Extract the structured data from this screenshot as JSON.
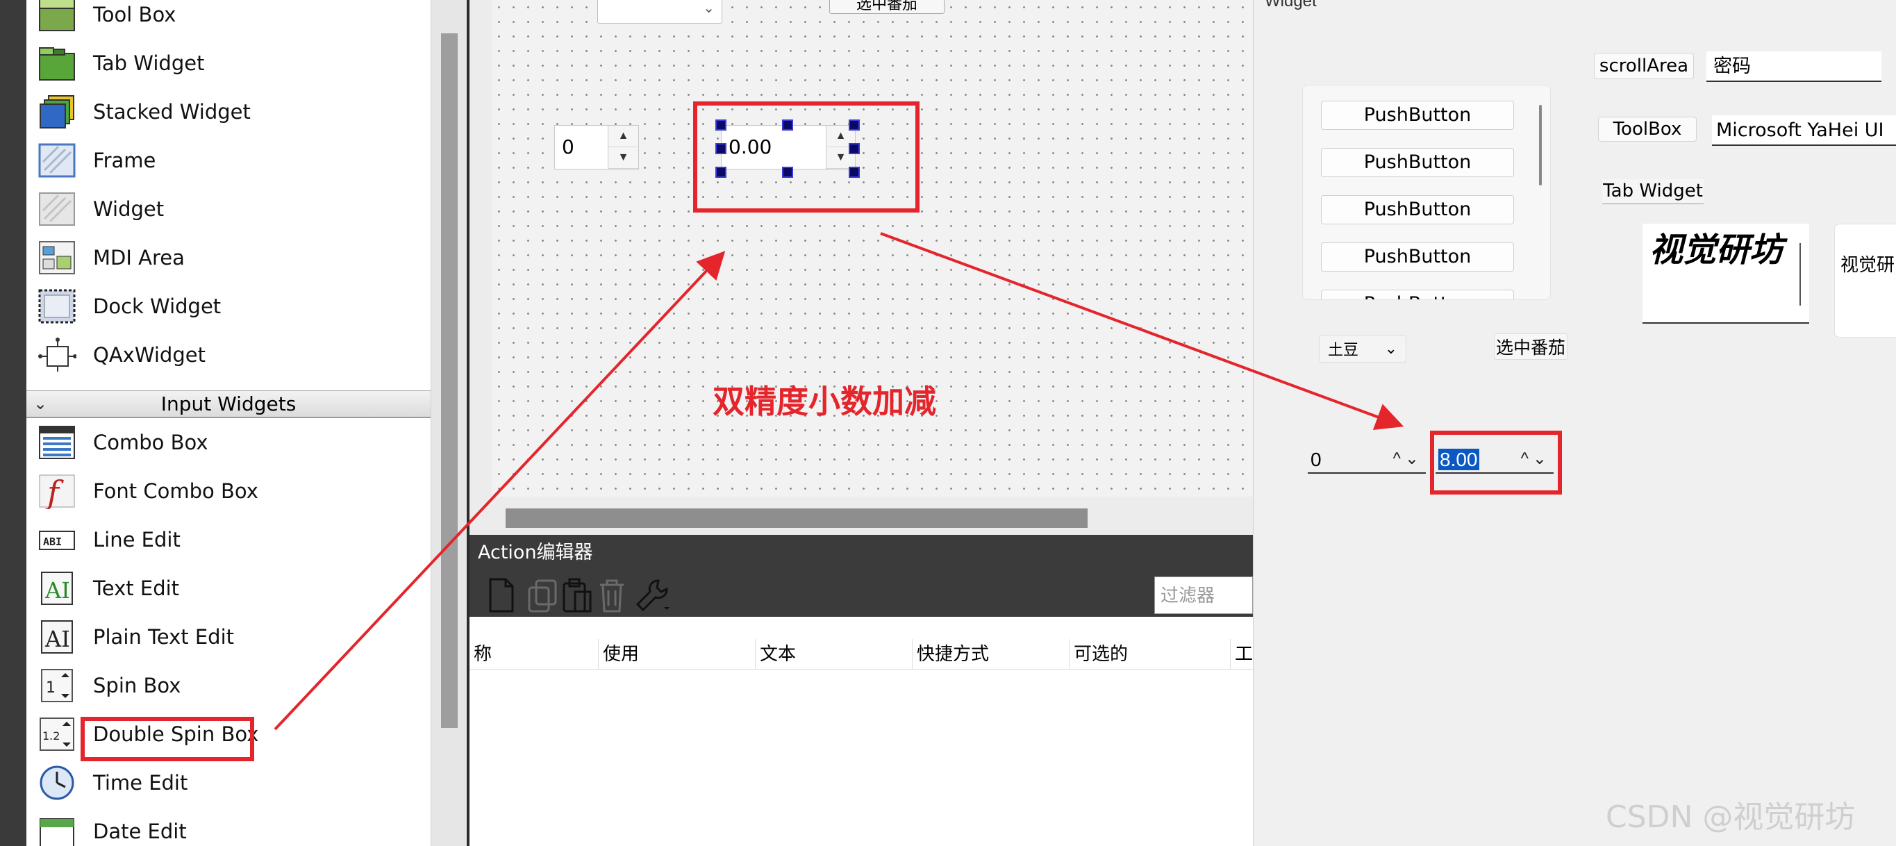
{
  "colors": {
    "annotation_red": "#e4252b",
    "selection_blue": "#0a58c2",
    "handle_navy": "#0a0a66",
    "dark_panel": "#3b3b3b"
  },
  "widget_box": {
    "items_top": [
      {
        "label": "Tool Box",
        "icon": "tool-box-icon"
      },
      {
        "label": "Tab Widget",
        "icon": "tab-widget-icon"
      },
      {
        "label": "Stacked Widget",
        "icon": "stacked-widget-icon"
      },
      {
        "label": "Frame",
        "icon": "frame-icon"
      },
      {
        "label": "Widget",
        "icon": "widget-icon"
      },
      {
        "label": "MDI Area",
        "icon": "mdi-area-icon"
      },
      {
        "label": "Dock Widget",
        "icon": "dock-widget-icon"
      },
      {
        "label": "QAxWidget",
        "icon": "qaxwidget-icon"
      }
    ],
    "category": "Input Widgets",
    "items_input": [
      {
        "label": "Combo Box",
        "icon": "combo-box-icon"
      },
      {
        "label": "Font Combo Box",
        "icon": "font-combo-box-icon"
      },
      {
        "label": "Line Edit",
        "icon": "line-edit-icon"
      },
      {
        "label": "Text Edit",
        "icon": "text-edit-icon"
      },
      {
        "label": "Plain Text Edit",
        "icon": "plain-text-edit-icon"
      },
      {
        "label": "Spin Box",
        "icon": "spin-box-icon"
      },
      {
        "label": "Double Spin Box",
        "icon": "double-spin-box-icon"
      },
      {
        "label": "Time Edit",
        "icon": "time-edit-icon"
      },
      {
        "label": "Date Edit",
        "icon": "date-edit-icon"
      }
    ]
  },
  "canvas": {
    "top_button": "选中番茄",
    "spin_value": "0",
    "double_spin_value": "0.00"
  },
  "annotation": {
    "text": "双精度小数加减"
  },
  "action_editor": {
    "title": "Action编辑器",
    "filter_placeholder": "过滤器",
    "columns": [
      "称",
      "使用",
      "文本",
      "快捷方式",
      "可选的",
      "工"
    ]
  },
  "preview": {
    "window_title": "Widget",
    "push_buttons": [
      "PushButton",
      "PushButton",
      "PushButton",
      "PushButton",
      "PushButton"
    ],
    "scroll_area_label": "scrollArea",
    "password_field": "密码",
    "toolbox_label": "ToolBox",
    "font_field": "Microsoft YaHei UI",
    "tab_widget_label": "Tab Widget",
    "big_text": "视觉研坊",
    "small_text": "视觉研",
    "combo_value": "土豆",
    "checkbox_label": "选中番茄",
    "spin_value": "0",
    "double_spin_value": "8.00"
  },
  "watermark": "CSDN @视觉研坊"
}
